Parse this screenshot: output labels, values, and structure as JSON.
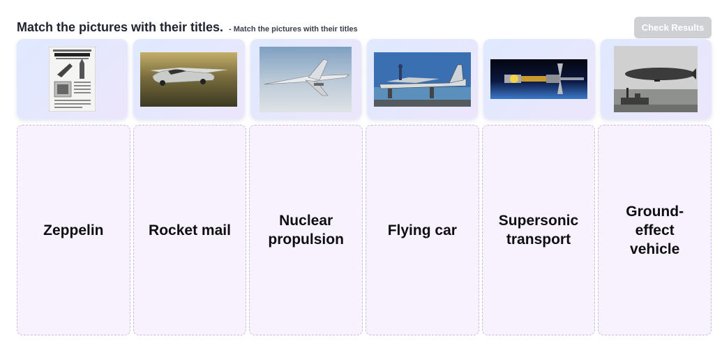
{
  "header": {
    "title": "Match the pictures with their titles.",
    "subtitle": "- Match the pictures with their titles"
  },
  "check_button": {
    "label": "Check Results"
  },
  "pictures": [
    {
      "icon": "newspaper-rocket-image"
    },
    {
      "icon": "flying-car-image"
    },
    {
      "icon": "supersonic-jet-image"
    },
    {
      "icon": "ground-effect-vehicle-image"
    },
    {
      "icon": "nuclear-spacecraft-image"
    },
    {
      "icon": "zeppelin-image"
    }
  ],
  "titles": [
    {
      "label": "Zeppelin"
    },
    {
      "label": "Rocket mail"
    },
    {
      "label": "Nuclear propulsion"
    },
    {
      "label": "Flying car"
    },
    {
      "label": "Supersonic transport"
    },
    {
      "label": "Ground-effect vehicle"
    }
  ],
  "colors": {
    "card_gradient_start": "#dfe9ff",
    "card_gradient_end": "#ece6fb",
    "drop_bg": "#f7f2fd",
    "drop_border": "#cbb9e6",
    "button_disabled": "#cfd0d4"
  }
}
